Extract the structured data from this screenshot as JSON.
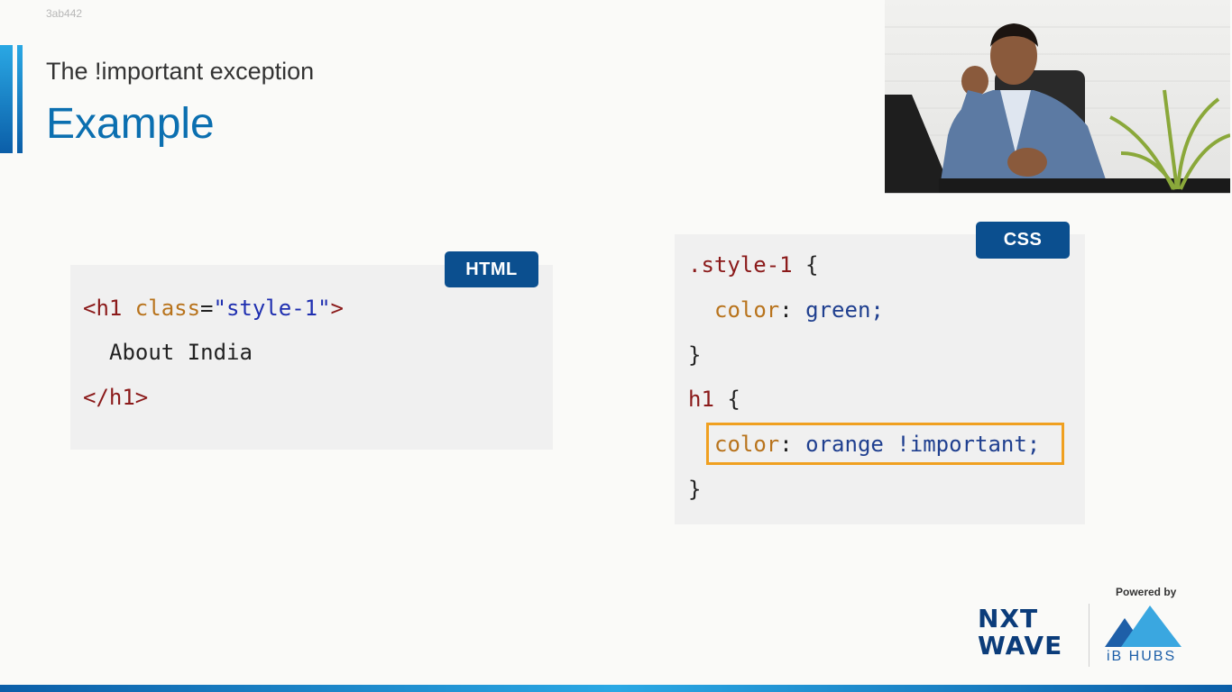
{
  "meta": {
    "watermark_id": "3ab442"
  },
  "slide": {
    "subtitle": "The !important exception",
    "title": "Example",
    "colors": {
      "accent": "#0b6fb0",
      "badge": "#0b4f8f",
      "highlight": "#f0a020"
    }
  },
  "html_panel": {
    "badge": "HTML",
    "line1": {
      "open": "<h1 ",
      "attr": "class",
      "eq": "=",
      "value": "\"style-1\"",
      "close": ">"
    },
    "line2": "About India",
    "line3": "</h1>"
  },
  "css_panel": {
    "badge": "CSS",
    "rule1": {
      "selector": ".style-1",
      "open": " {",
      "prop": "color",
      "colon": ": ",
      "value": "green;",
      "close": "}"
    },
    "rule2": {
      "selector": "h1",
      "open": " {",
      "prop": "color",
      "colon": ": ",
      "value": "orange !important;",
      "close": "}"
    }
  },
  "branding": {
    "powered_by": "Powered by",
    "nxtwave_line1": "NXT",
    "nxtwave_line2": "WAVE",
    "ibhubs": "iB HUBS"
  }
}
